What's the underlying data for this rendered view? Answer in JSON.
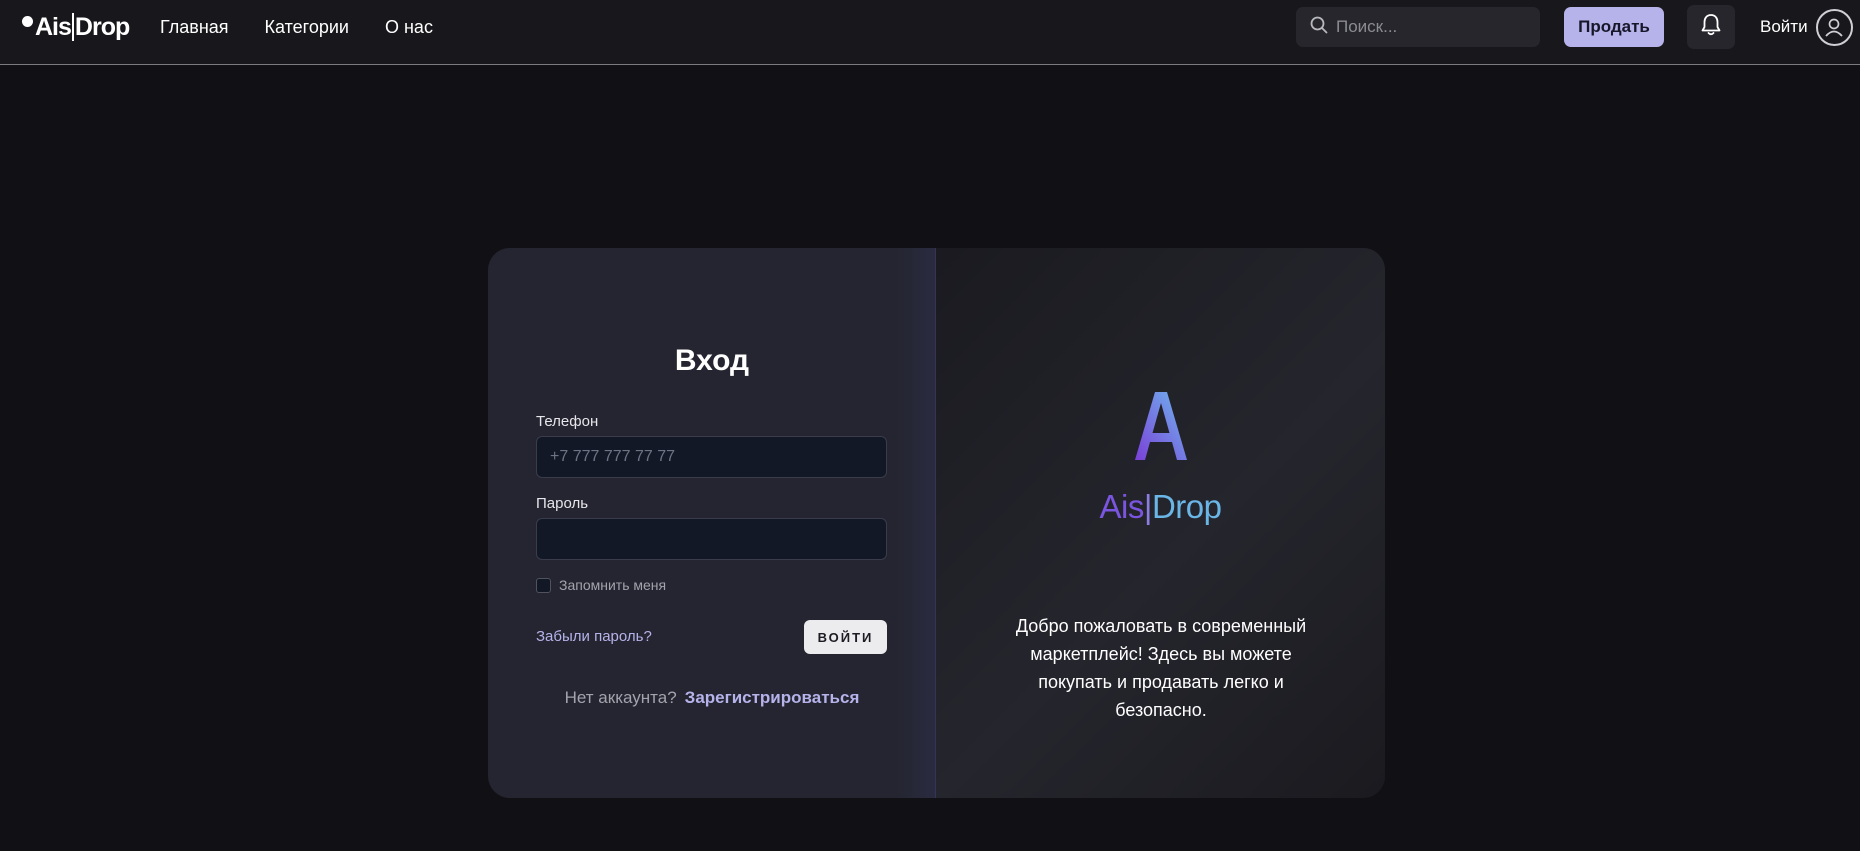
{
  "header": {
    "logo_left": "Ais",
    "logo_right": "Drop",
    "nav": [
      "Главная",
      "Категории",
      "О нас"
    ],
    "search_placeholder": "Поиск...",
    "sell_label": "Продать",
    "login_label": "Войти"
  },
  "login_form": {
    "title": "Вход",
    "phone_label": "Телефон",
    "phone_placeholder": "+7 777 777 77 77",
    "password_label": "Пароль",
    "password_value": "",
    "remember_label": "Запомнить меня",
    "remember_checked": false,
    "forgot_label": "Забыли пароль?",
    "submit_label": "ВОЙТИ",
    "no_account_label": "Нет аккаунта?",
    "register_label": "Зарегистрироваться"
  },
  "promo": {
    "brand_letter": "A",
    "brand_ais": "Ais",
    "brand_drop": "Drop",
    "welcome_text": "Добро пожаловать в современный маркетплейс! Здесь вы можете покупать и продавать легко и безопасно."
  },
  "colors": {
    "accent": "#b6b2ea",
    "brand_purple": "#7a55e0",
    "brand_blue": "#6ab6e6"
  },
  "icons": [
    "search-icon",
    "bell-icon",
    "user-icon"
  ]
}
